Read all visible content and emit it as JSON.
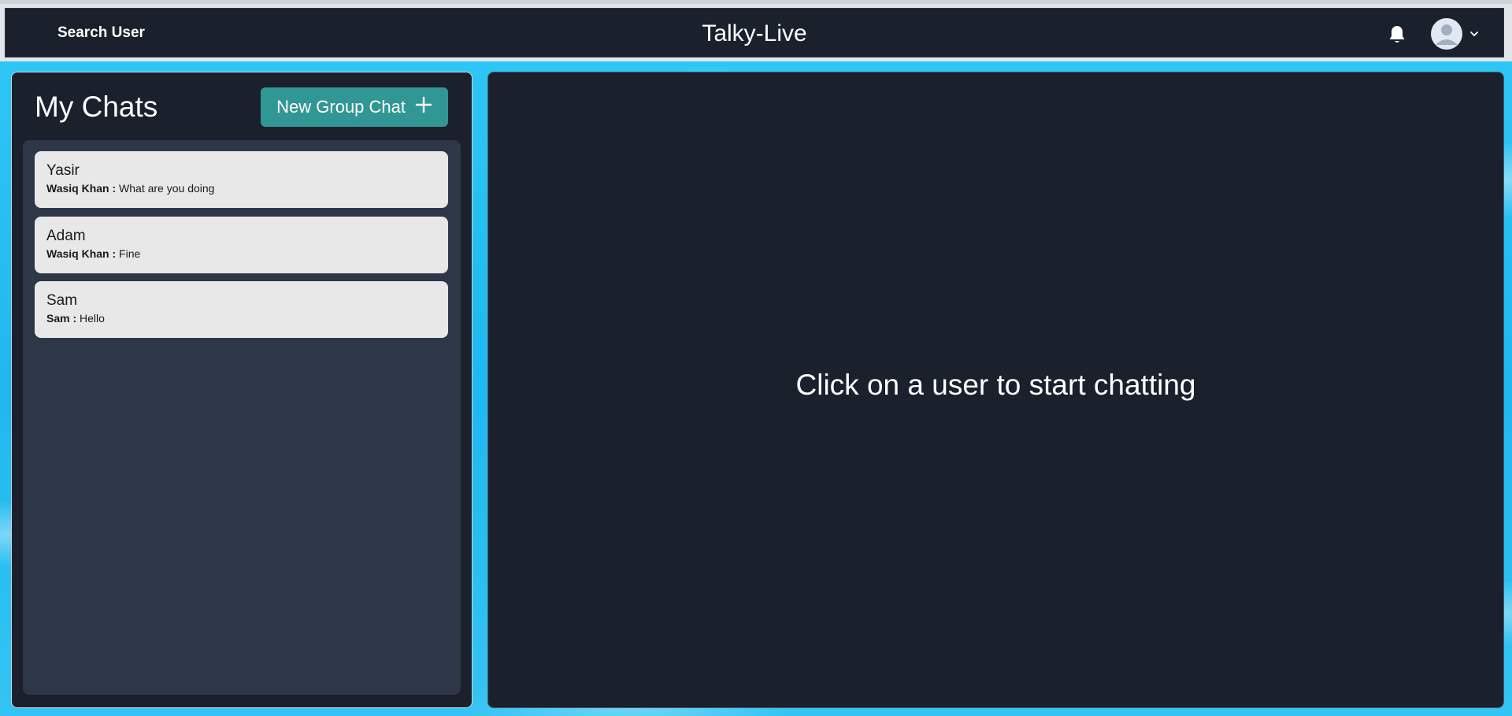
{
  "header": {
    "search_label": "Search User",
    "app_title": "Talky-Live"
  },
  "icons": {
    "bell": "bell-icon",
    "avatar": "user-avatar-icon",
    "chevron": "chevron-down-icon",
    "plus": "plus-icon"
  },
  "chats": {
    "title": "My Chats",
    "new_group_label": "New Group Chat",
    "items": [
      {
        "name": "Yasir",
        "sender": "Wasiq Khan :",
        "message": " What are you doing"
      },
      {
        "name": "Adam",
        "sender": "Wasiq Khan :",
        "message": " Fine"
      },
      {
        "name": "Sam",
        "sender": "Sam :",
        "message": " Hello"
      }
    ]
  },
  "chatbox": {
    "placeholder": "Click on a user to start chatting"
  },
  "colors": {
    "navbar_bg": "#1a202c",
    "panel_bg": "#1a202c",
    "list_bg": "#2d3748",
    "item_bg": "#e8e8e8",
    "accent_teal": "#319795",
    "background_blue": "#2ec6f5"
  }
}
